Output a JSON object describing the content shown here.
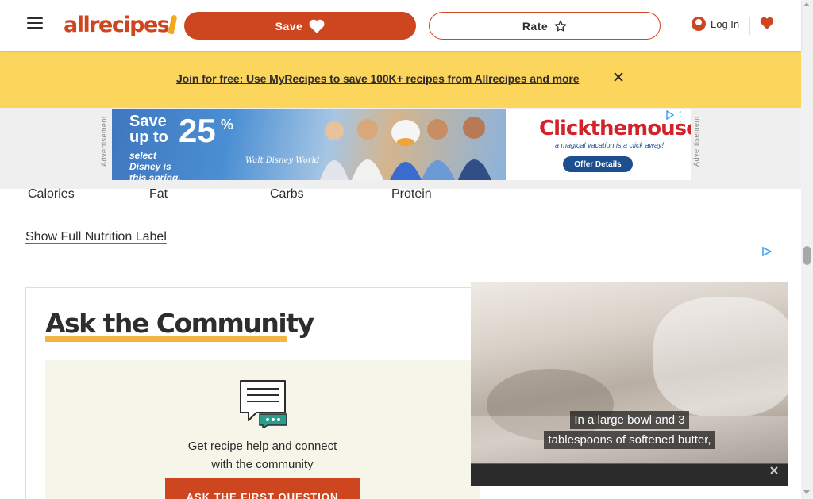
{
  "header": {
    "logo_text": "allrecipes",
    "save_label": "Save",
    "rate_label": "Rate",
    "login_label": "Log In"
  },
  "banner": {
    "link_text": "Join for free: Use MyRecipes to save 100K+ recipes from Allrecipes and more"
  },
  "ads": {
    "label": "Advertisement",
    "creative": {
      "headline_prefix": "Save up to",
      "headline_value": "25",
      "headline_unit": "%",
      "subline": "select Disney is this spring.",
      "resort": "Walt Disney World",
      "brand": "Clickthemouse",
      "tagline": "a magical vacation is a click away!",
      "cta": "Offer Details"
    }
  },
  "nutrition": {
    "items": [
      "Calories",
      "Fat",
      "Carbs",
      "Protein"
    ],
    "show_label": "Show Full Nutrition Label"
  },
  "community": {
    "title": "Ask the Community",
    "text_line1": "Get recipe help and connect",
    "text_line2": "with the community",
    "button_label": "ASK THE FIRST QUESTION"
  },
  "video": {
    "caption_line1": "In a large bowl and 3",
    "caption_line2": "tablespoons of softened butter,"
  },
  "colors": {
    "brand": "#ce4620",
    "banner": "#fcd55d",
    "accent_underline": "#f2b13a"
  }
}
